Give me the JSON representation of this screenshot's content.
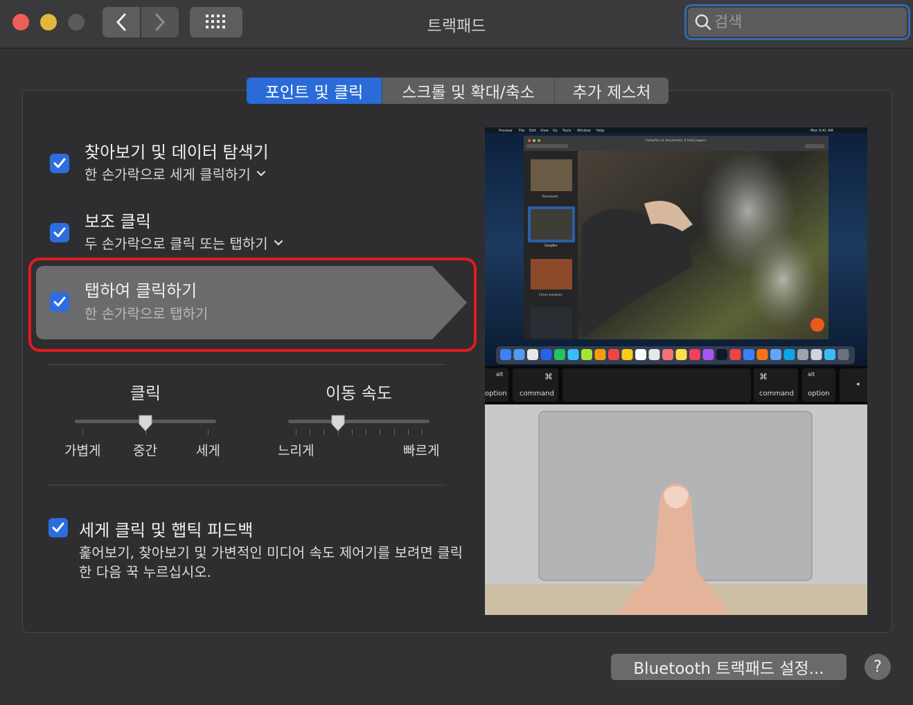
{
  "window": {
    "title": "트랙패드"
  },
  "search": {
    "placeholder": "검색"
  },
  "tabs": [
    {
      "label": "포인트 및 클릭",
      "active": true
    },
    {
      "label": "스크롤 및 확대/축소",
      "active": false
    },
    {
      "label": "추가 제스처",
      "active": false
    }
  ],
  "options": [
    {
      "title": "찾아보기 및 데이터 탐색기",
      "subtitle": "한 손가락으로 세게 클릭하기",
      "checked": true
    },
    {
      "title": "보조 클릭",
      "subtitle": "두 손가락으로 클릭 또는 탭하기",
      "checked": true
    },
    {
      "title": "탭하여 클릭하기",
      "subtitle": "한 손가락으로 탭하기",
      "checked": true,
      "highlighted": true
    }
  ],
  "click_slider": {
    "title": "클릭",
    "labels": [
      "가볍게",
      "중간",
      "세게"
    ],
    "value_index": 1
  },
  "speed_slider": {
    "title": "이동 속도",
    "min_label": "느리게",
    "max_label": "빠르게",
    "value_fraction": 0.35
  },
  "force_click": {
    "title": "세게 클릭 및 햅틱 피드백",
    "description": "훑어보기, 찾아보기 및 가변적인 미디어 속도 제어기를 보려면 클릭한 다음 꾹 누르십시오.",
    "checked": true
  },
  "preview": {
    "menubar": [
      "Preview",
      "File",
      "Edit",
      "View",
      "Go",
      "Tools",
      "Window",
      "Help"
    ],
    "clock": "Mon 9:41 AM",
    "doc_title": "Campfire (4 documents, 4 total pages)",
    "thumbnails": [
      "Backwoods",
      "Campfire",
      "Cherry tomatoes",
      ""
    ],
    "keys": {
      "left_option": "option",
      "left_alt": "alt",
      "left_command": "command",
      "cmd_symbol": "⌘",
      "right_command": "command",
      "right_alt": "alt",
      "right_option": "option",
      "arrow": "◂"
    }
  },
  "footer": {
    "bluetooth_button": "Bluetooth 트랙패드 설정...",
    "help": "?"
  }
}
